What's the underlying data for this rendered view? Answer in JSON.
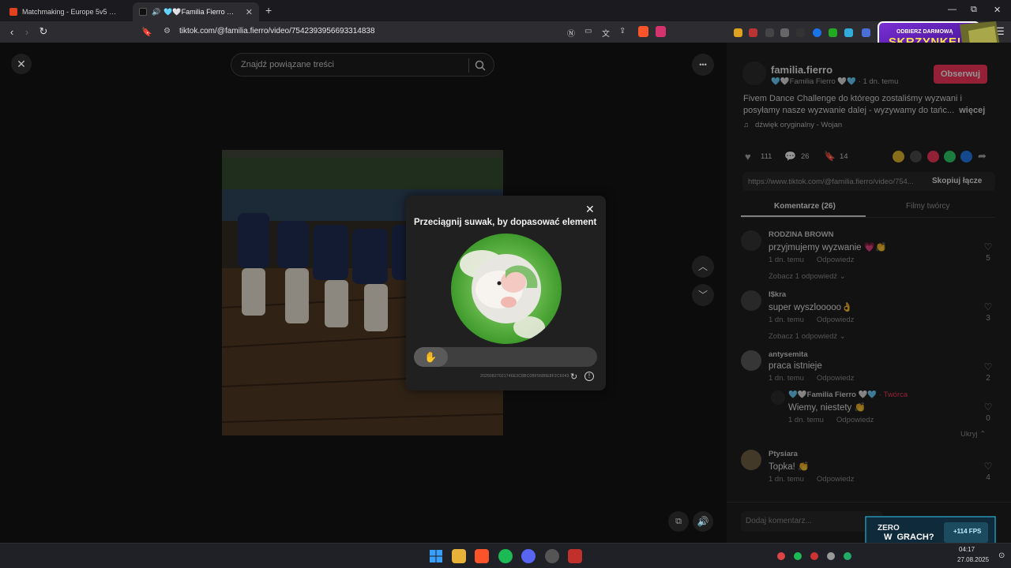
{
  "browser": {
    "tabs": [
      {
        "title": "Matchmaking - Europe 5v5 Queue -",
        "active": false
      },
      {
        "title": "🩵🤍Familia Fierro 🤍🩵 (@",
        "active": true
      }
    ],
    "new_tab": "+",
    "url": "tiktok.com/@familia.fierro/video/7542393956693314838",
    "window_controls": {
      "minimize": "—",
      "restore": "⧉",
      "close": "✕"
    }
  },
  "promo_ad": {
    "top_line": "ODBIERZ DARMOWĄ",
    "big_line": "SKRZYNKĘ!"
  },
  "video_page": {
    "close": "✕",
    "search_placeholder": "Znajdź powiązane treści",
    "more": "•••"
  },
  "captcha": {
    "title": "Przeciągnij suwak, by dopasować element",
    "close": "✕",
    "id": "20250827021746E3C8BC0BF5686E8F2C6043",
    "slider_progress": 0
  },
  "author": {
    "username": "familia.fierro",
    "display": "🩵🤍Familia Fierro 🤍🩵 · 1 dn. temu",
    "follow": "Obserwuj",
    "description": "Fivem Dance Challenge do którego zostaliśmy wyzwani i posyłamy nasze wyzwanie dalej - wyzywamy do tańc...",
    "more": "więcej",
    "sound": "dźwięk oryginalny - Wojan"
  },
  "stats": {
    "likes": "111",
    "comments": "26",
    "saves": "14"
  },
  "share": {
    "link": "https://www.tiktok.com/@familia.fierro/video/754...",
    "copy": "Skopiuj łącze"
  },
  "tabs": {
    "comments": "Komentarze (26)",
    "creator_videos": "Filmy twórcy"
  },
  "comments": [
    {
      "name": "RODZINA BROWN",
      "text": "przyjmujemy wyzwanie 💗👏",
      "time": "1 dn. temu",
      "reply": "Odpowiedz",
      "likes": "5",
      "more": "Zobacz 1 odpowiedź ⌄"
    },
    {
      "name": "I$kra",
      "text": "super wyszlooooo👌",
      "time": "1 dn. temu",
      "reply": "Odpowiedz",
      "likes": "3",
      "more": "Zobacz 1 odpowiedź ⌄"
    },
    {
      "name": "antysemita",
      "text": "praca istnieje",
      "time": "1 dn. temu",
      "reply": "Odpowiedz",
      "likes": "2"
    },
    {
      "name": "Ptysiara",
      "text": "Topka! 👏",
      "time": "1 dn. temu",
      "reply": "Odpowiedz",
      "likes": "4"
    }
  ],
  "reply": {
    "name": "🩵🤍Familia Fierro 🤍🩵",
    "badge": "· Twórca",
    "text": "Wiemy, niestety 👏",
    "time": "1 dn. temu",
    "reply": "Odpowiedz",
    "likes": "0",
    "hide": "Ukryj ⌃"
  },
  "add_comment_placeholder": "Dodaj komentarz...",
  "bottom_ad": {
    "line1": "ZERO",
    "line2": "W  GRACH?",
    "fps": "+114 FPS"
  },
  "taskbar": {
    "time": "04:17",
    "date": "27.08.2025"
  }
}
